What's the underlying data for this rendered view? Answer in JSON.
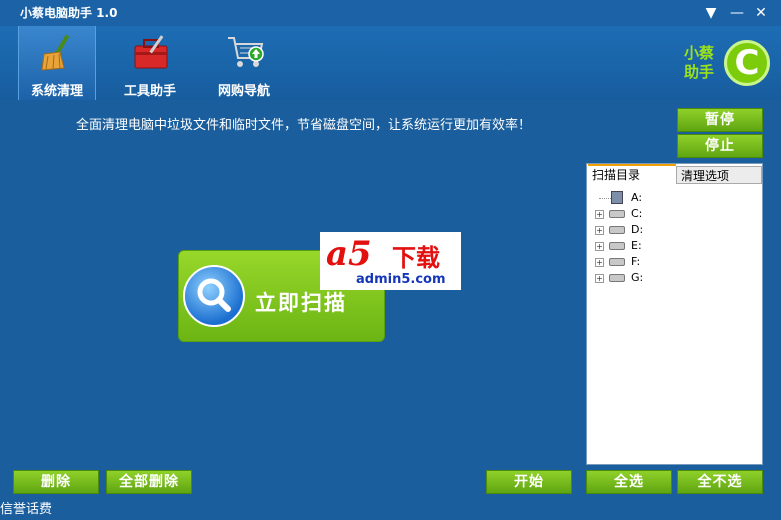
{
  "window": {
    "title": "小蔡电脑助手 1.0"
  },
  "nav": [
    {
      "label": "系统清理",
      "active": true,
      "icon": "broom-icon"
    },
    {
      "label": "工具助手",
      "active": false,
      "icon": "toolbox-icon"
    },
    {
      "label": "网购导航",
      "active": false,
      "icon": "shopping-cart-icon"
    }
  ],
  "logo": {
    "line1": "小蔡",
    "line2": "助手",
    "letter": "C"
  },
  "description": "全面清理电脑中垃圾文件和临时文件，节省磁盘空间，让系统运行更加有效率！",
  "buttons": {
    "pause": "暂停",
    "stop": "停止",
    "delete": "删除",
    "delete_all": "全部删除",
    "start": "开始",
    "select_all": "全选",
    "select_none": "全不选"
  },
  "scan": {
    "label": "立即扫描",
    "icon": "magnifier-icon"
  },
  "watermark": {
    "brand": "a5",
    "suffix": "下载",
    "url": "admin5.com"
  },
  "panel": {
    "tabs": [
      "扫描目录",
      "清理选项"
    ],
    "drives": [
      "A:",
      "C:",
      "D:",
      "E:",
      "F:",
      "G:"
    ]
  },
  "footer": "信誉话费",
  "colors": {
    "background": "#1a5e9e",
    "green": "#6cb514",
    "logo_green": "#7ccc0c",
    "tab_accent": "#f0a000"
  }
}
